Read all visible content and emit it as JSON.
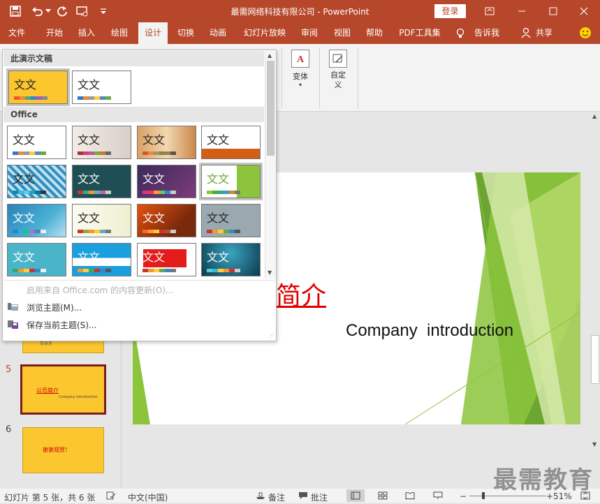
{
  "window": {
    "title": "最需网络科技有限公司  -  PowerPoint",
    "login_label": "登录"
  },
  "quick_access": {
    "save": "save-icon",
    "undo": "undo-icon",
    "redo": "redo-icon",
    "start": "present-from-start-icon",
    "customize": "customize-qat-icon"
  },
  "menu": [
    {
      "label": "文件"
    },
    {
      "label": "开始"
    },
    {
      "label": "插入"
    },
    {
      "label": "绘图"
    },
    {
      "label": "设计"
    },
    {
      "label": "切换"
    },
    {
      "label": "动画"
    },
    {
      "label": "幻灯片放映"
    },
    {
      "label": "审阅"
    },
    {
      "label": "视图"
    },
    {
      "label": "帮助"
    },
    {
      "label": "PDF工具集"
    },
    {
      "label": "告诉我"
    },
    {
      "label": "共享"
    }
  ],
  "ribbon": {
    "variants_label": "变体",
    "customize_label": "自定义"
  },
  "theme_popup": {
    "section1_title": "此演示文稿",
    "section2_title": "Office",
    "theme_text": "文文",
    "footer": {
      "office_update": "启用来自 Office.com 的内容更新(O)...",
      "browse": "浏览主题(M)...",
      "save": "保存当前主题(S)..."
    }
  },
  "slides": {
    "numbers": [
      "5",
      "6"
    ],
    "thumb5_title": "公司简介",
    "thumb5_sub": "Company  introduction",
    "thumb6_title": "谢谢观赏！",
    "thumb4_sub": "目录页"
  },
  "main_slide": {
    "title": "简介",
    "subtitle": "Company  introduction"
  },
  "status": {
    "slide_info": "幻灯片 第 5 张，共 6 张",
    "language": "中文(中国)",
    "notes": "备注",
    "comments": "批注",
    "zoom": "51%"
  },
  "watermark": "最需教育",
  "colors": {
    "accent": "#b7472a",
    "slide_green": "#8cc43c"
  }
}
